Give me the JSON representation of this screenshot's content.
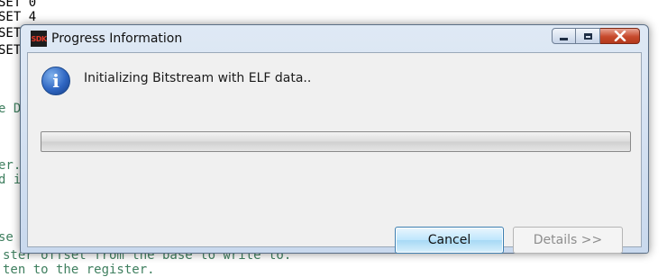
{
  "editor": {
    "lines": [
      {
        "text": "SET 0",
        "comment": false
      },
      {
        "text": "SET 4",
        "comment": false
      },
      {
        "text": "SET",
        "comment": false
      },
      {
        "text": "SET",
        "comment": false
      },
      {
        "text": "e D",
        "comment": true
      },
      {
        "text": "er.",
        "comment": true
      },
      {
        "text": "d i",
        "comment": true
      },
      {
        "text": "se",
        "comment": true
      },
      {
        "text": "ster offset from the base to write to.",
        "comment": true
      },
      {
        "text": "ten to the register.",
        "comment": true
      }
    ]
  },
  "dialog": {
    "app_icon_text": "SDK",
    "title": "Progress Information",
    "message": "Initializing Bitstream with ELF data..",
    "progress": 0.0,
    "cancel_label": "Cancel",
    "details_label": "Details >>",
    "colors": {
      "close_button": "#c7492c",
      "info_icon": "#2f66c2",
      "cancel_border": "#3c7fb1"
    }
  }
}
